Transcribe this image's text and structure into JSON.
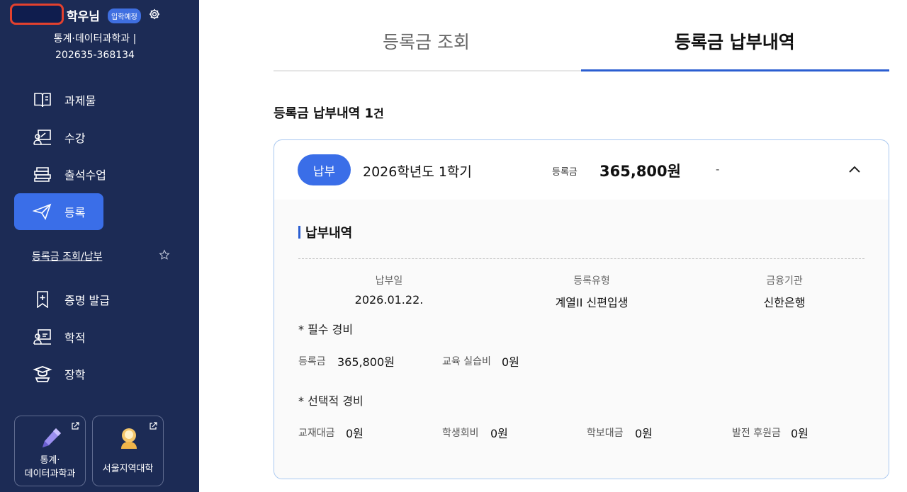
{
  "sidebar": {
    "user_name": "학우님",
    "badge": "입학예정",
    "department": "통계·데이터과학과 |",
    "student_no": "202635-368134",
    "nav": [
      {
        "label": "과제물",
        "icon": "book-icon"
      },
      {
        "label": "수강",
        "icon": "classroom-icon"
      },
      {
        "label": "출석수업",
        "icon": "books-stack-icon"
      },
      {
        "label": "등록",
        "icon": "paper-plane-icon"
      },
      {
        "label": "증명 발급",
        "icon": "bookmark-plus-icon"
      },
      {
        "label": "학적",
        "icon": "presentation-icon"
      },
      {
        "label": "장학",
        "icon": "graduate-icon"
      }
    ],
    "sub_link": "등록금 조회/납부",
    "quick_links": [
      {
        "label_1": "통계·",
        "label_2": "데이터과학과",
        "icon": "pencil-icon"
      },
      {
        "label_1": "서울지역대학",
        "icon": "mascot-icon"
      }
    ]
  },
  "tabs": {
    "inquiry": "등록금 조회",
    "history": "등록금 납부내역"
  },
  "main": {
    "count_title": "등록금 납부내역",
    "count_num": "1",
    "count_unit": "건",
    "card": {
      "status": "납부",
      "term": "2026학년도 1학기",
      "fee_label": "등록금",
      "fee_amount": "365,800원",
      "dash": "-",
      "section_title": "납부내역",
      "columns": [
        {
          "header": "납부일",
          "value": "2026.01.22."
        },
        {
          "header": "등록유형",
          "value": "계열II 신편입생"
        },
        {
          "header": "금융기관",
          "value": "신한은행"
        }
      ],
      "required_title": "* 필수 경비",
      "required": [
        {
          "label": "등록금",
          "value": "365,800원"
        },
        {
          "label": "교육 실습비",
          "value": "0원"
        }
      ],
      "optional_title": "* 선택적 경비",
      "optional": [
        {
          "label": "교재대금",
          "value": "0원"
        },
        {
          "label": "학생회비",
          "value": "0원"
        },
        {
          "label": "학보대금",
          "value": "0원"
        },
        {
          "label": "발전 후원금",
          "value": "0원"
        }
      ]
    }
  },
  "colors": {
    "sidebar_bg": "#1c2b55",
    "accent": "#3a6ee8",
    "card_border": "#a9c8f0",
    "highlight": "#e3412e"
  }
}
